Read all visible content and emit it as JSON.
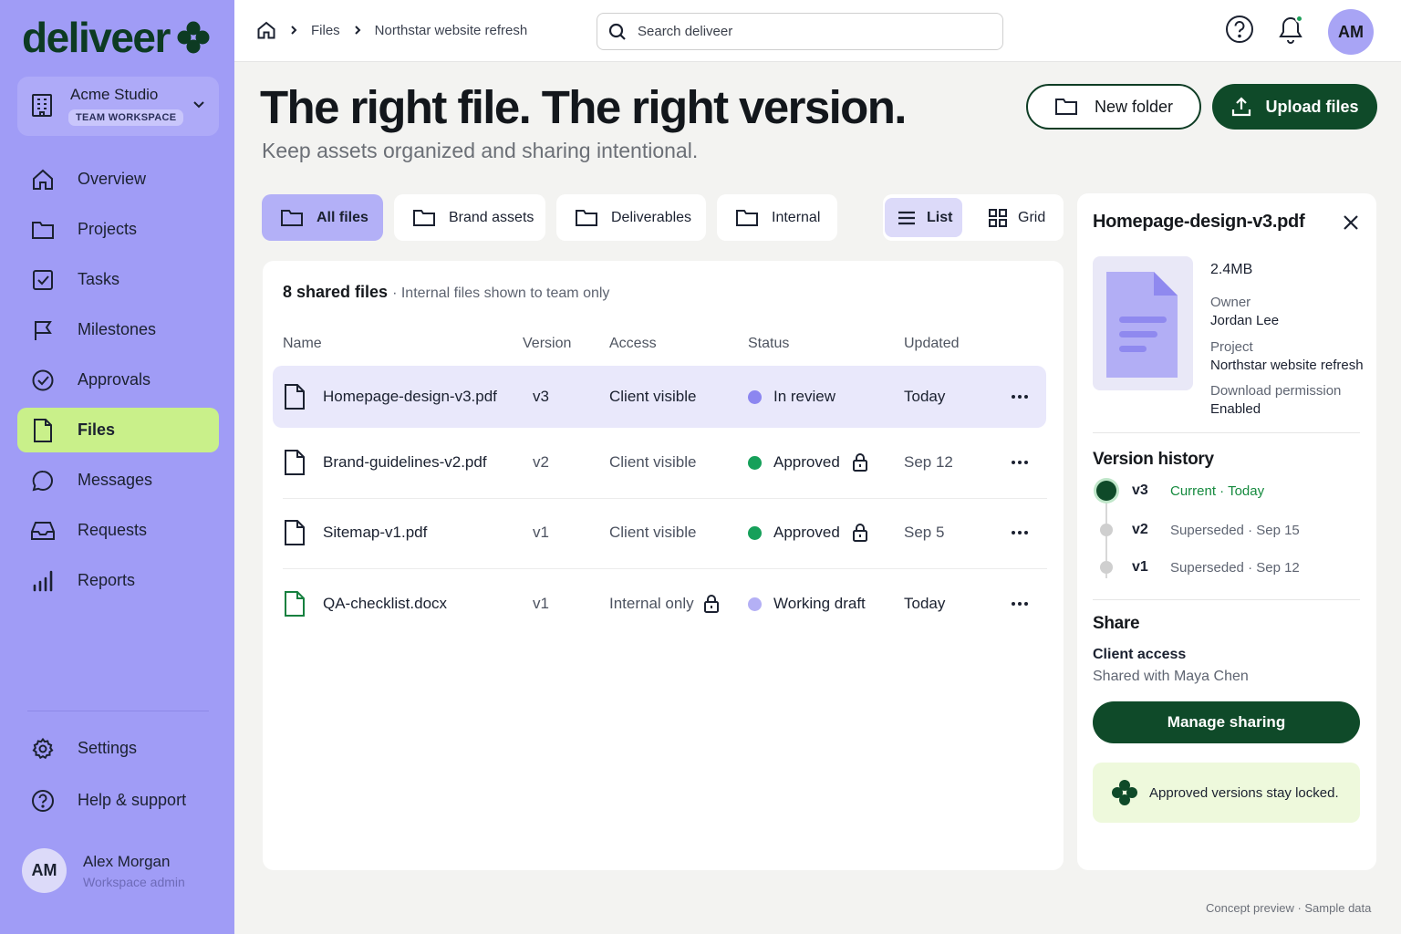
{
  "app": {
    "name": "deliveer",
    "accent": "#a09cf6",
    "brand_green": "#0f4a29",
    "lime": "#c9f08a"
  },
  "workspace": {
    "name": "Acme Studio",
    "badge": "TEAM WORKSPACE"
  },
  "sidebar": {
    "items": [
      {
        "label": "Overview",
        "icon": "home-icon"
      },
      {
        "label": "Projects",
        "icon": "folder-icon"
      },
      {
        "label": "Tasks",
        "icon": "checkbox-icon"
      },
      {
        "label": "Milestones",
        "icon": "flag-icon"
      },
      {
        "label": "Approvals",
        "icon": "check-circle-icon"
      },
      {
        "label": "Files",
        "icon": "file-icon",
        "active": true
      },
      {
        "label": "Messages",
        "icon": "chat-icon"
      },
      {
        "label": "Requests",
        "icon": "inbox-icon"
      },
      {
        "label": "Reports",
        "icon": "bar-chart-icon"
      }
    ],
    "bottom": [
      {
        "label": "Settings",
        "icon": "gear-icon"
      },
      {
        "label": "Help & support",
        "icon": "help-icon"
      }
    ],
    "user": {
      "initials": "AM",
      "name": "Alex Morgan",
      "role": "Workspace admin"
    }
  },
  "topbar": {
    "breadcrumb": [
      "Files",
      "Northstar website refresh"
    ],
    "search_placeholder": "Search deliveer",
    "avatar_initials": "AM"
  },
  "hero": {
    "title": "The right file. The right version.",
    "subtitle": "Keep assets organized and sharing intentional.",
    "new_folder": "New folder",
    "upload": "Upload files"
  },
  "filters": [
    "All files",
    "Brand assets",
    "Deliverables",
    "Internal"
  ],
  "view": {
    "list": "List",
    "grid": "Grid",
    "active": "List"
  },
  "files": {
    "count_label": "8 shared files",
    "count_note": "· Internal files shown to team only",
    "columns": [
      "Name",
      "Version",
      "Access",
      "Status",
      "Updated"
    ],
    "rows": [
      {
        "name": "Homepage-design-v3.pdf",
        "version": "v3",
        "access": "Client visible",
        "status": "In review",
        "status_color": "#8c86f0",
        "updated": "Today",
        "selected": true
      },
      {
        "name": "Brand-guidelines-v2.pdf",
        "version": "v2",
        "access": "Client visible",
        "status": "Approved",
        "status_color": "#16a05a",
        "locked": true,
        "updated": "Sep 12"
      },
      {
        "name": "Sitemap-v1.pdf",
        "version": "v1",
        "access": "Client visible",
        "status": "Approved",
        "status_color": "#16a05a",
        "locked": true,
        "updated": "Sep 5"
      },
      {
        "name": "QA-checklist.docx",
        "version": "v1",
        "access": "Internal only",
        "access_locked": true,
        "status": "Working draft",
        "status_color": "#b4b0f5",
        "updated": "Today",
        "doc": true
      }
    ]
  },
  "details": {
    "filename": "Homepage-design-v3.pdf",
    "size": "2.4MB",
    "owner_label": "Owner",
    "owner": "Jordan Lee",
    "project_label": "Project",
    "project": "Northstar website refresh",
    "download_label": "Download permission",
    "download": "Enabled",
    "version_history_title": "Version history",
    "versions": [
      {
        "v": "v3",
        "note": "Current · Today",
        "current": true
      },
      {
        "v": "v2",
        "note": "Superseded · Sep 15"
      },
      {
        "v": "v1",
        "note": "Superseded · Sep 12"
      }
    ],
    "share_title": "Share",
    "client_access_label": "Client access",
    "shared_with": "Shared with Maya Chen",
    "manage_button": "Manage sharing",
    "note": "Approved versions stay locked."
  },
  "footer": "Concept preview · Sample data"
}
